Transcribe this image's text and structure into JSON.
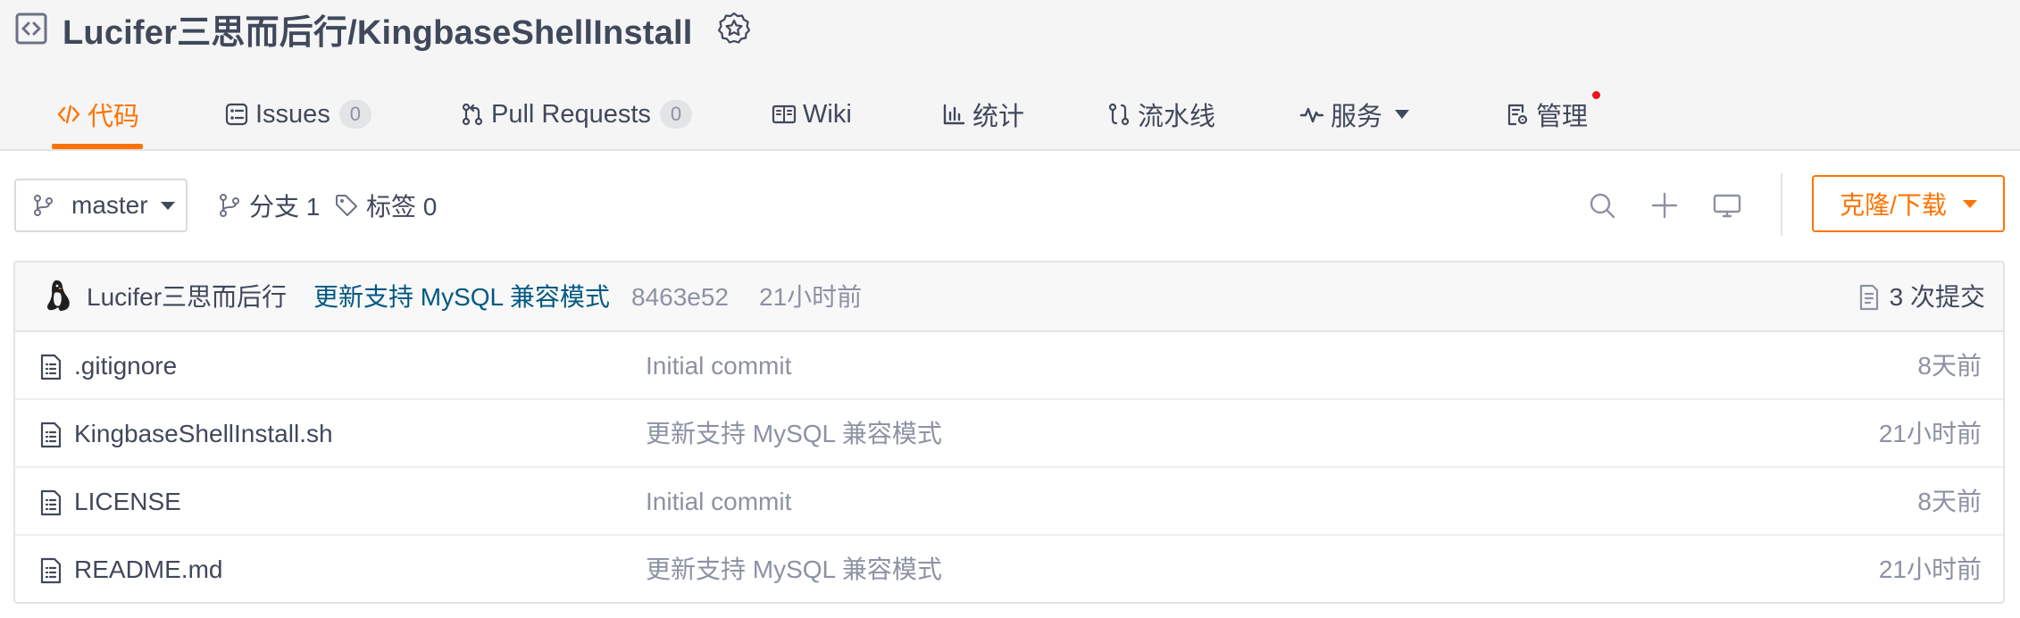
{
  "repo": {
    "title": "Lucifer三思而后行/KingbaseShellInstall"
  },
  "tabs": [
    {
      "label": "代码",
      "icon": "code-icon",
      "active": true
    },
    {
      "label": "Issues",
      "icon": "issues-icon",
      "count": "0"
    },
    {
      "label": "Pull Requests",
      "icon": "pull-request-icon",
      "count": "0"
    },
    {
      "label": "Wiki",
      "icon": "book-icon"
    },
    {
      "label": "统计",
      "icon": "bar-chart-icon"
    },
    {
      "label": "流水线",
      "icon": "pipeline-icon"
    },
    {
      "label": "服务",
      "icon": "pulse-icon",
      "dropdown": true
    },
    {
      "label": "管理",
      "icon": "manage-icon",
      "notify_dot": true
    }
  ],
  "toolbar": {
    "branch": "master",
    "branches_label": "分支 1",
    "tags_label": "标签 0",
    "clone_label": "克隆/下载"
  },
  "commit": {
    "author": "Lucifer三思而后行",
    "message": "更新支持 MySQL 兼容模式",
    "hash": "8463e52",
    "time": "21小时前",
    "total": "3 次提交"
  },
  "files": [
    {
      "name": ".gitignore",
      "message": "Initial commit",
      "time": "8天前"
    },
    {
      "name": "KingbaseShellInstall.sh",
      "message": "更新支持 MySQL 兼容模式",
      "time": "21小时前"
    },
    {
      "name": "LICENSE",
      "message": "Initial commit",
      "time": "8天前"
    },
    {
      "name": "README.md",
      "message": "更新支持 MySQL 兼容模式",
      "time": "21小时前"
    }
  ],
  "colors": {
    "accent": "#fe7300",
    "text": "#40485b",
    "muted": "#8c92a4",
    "link": "#005980",
    "notify": "#f0131e"
  }
}
